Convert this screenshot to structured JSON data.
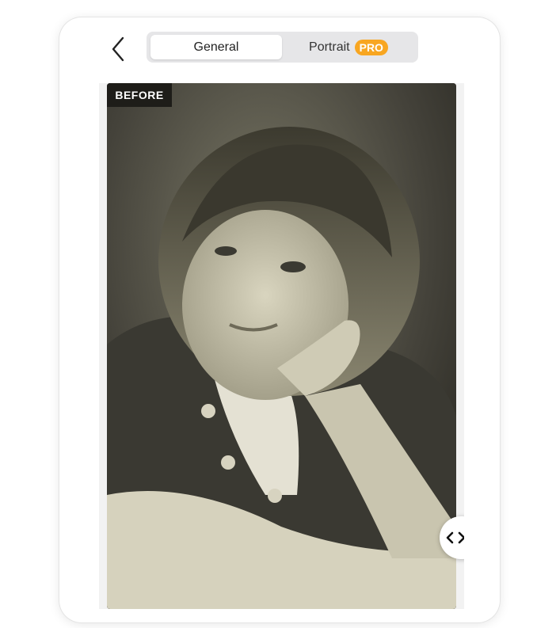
{
  "header": {
    "back_icon": "chevron-left-icon",
    "tabs": [
      {
        "label": "General",
        "selected": true
      },
      {
        "label": "Portrait",
        "selected": false,
        "badge": "PRO"
      }
    ]
  },
  "photo": {
    "label": "BEFORE"
  },
  "compare_handle": {
    "icon": "left-right-arrows-icon"
  },
  "colors": {
    "pro_badge": "#f8a621",
    "selected_tab": "#ffffff",
    "segmented_bg": "#e6e6e8",
    "before_label_bg": "#1e1d19"
  }
}
